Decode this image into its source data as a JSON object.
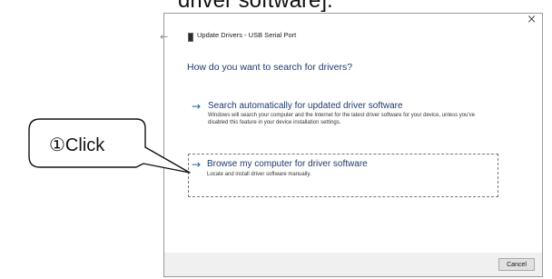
{
  "document": {
    "heading_fragment": "driver software]."
  },
  "dialog": {
    "close_glyph": "×",
    "back_glyph": "←",
    "window_title": "Update Drivers - USB Serial Port",
    "question": "How do you want to search for drivers?",
    "options": [
      {
        "arrow_glyph": "→",
        "title": "Search automatically for updated driver software",
        "description": "Windows will search your computer and the Internet for the latest driver software for your device, unless you've disabled this feature in your device installation settings."
      },
      {
        "arrow_glyph": "→",
        "title": "Browse my computer for driver software",
        "description": "Locate and install driver software manually.",
        "focused": true
      }
    ],
    "cancel_label": "Cancel"
  },
  "callout": {
    "text": "①Click"
  },
  "colors": {
    "link_blue": "#1e3a6e",
    "arrow_blue": "#2a5d9a",
    "footer_gray": "#f0f0f0"
  }
}
